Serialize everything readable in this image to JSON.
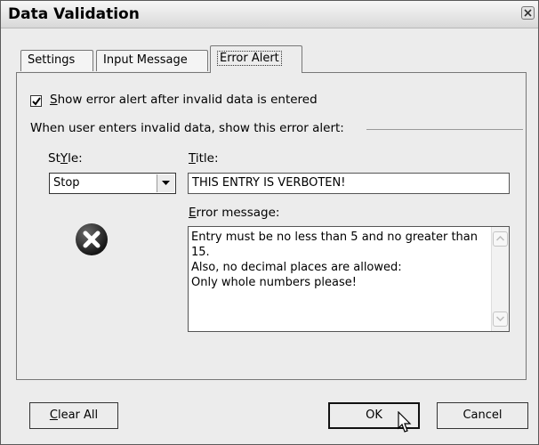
{
  "window": {
    "title": "Data Validation"
  },
  "tabs": [
    {
      "label": "Settings",
      "selected": false
    },
    {
      "label": "Input Message",
      "selected": false
    },
    {
      "label": "Error Alert",
      "selected": true
    }
  ],
  "show_error_checkbox": {
    "label_accel": "S",
    "label_rest": "how error alert after invalid data is entered",
    "checked": true
  },
  "group_label": "When user enters invalid data, show this error alert:",
  "style": {
    "label_accel": "Y",
    "label_before": "St",
    "label_after": "le:",
    "selected": "Stop",
    "icon": "stop-x-icon"
  },
  "title_field": {
    "label_accel": "T",
    "label_rest": "itle:",
    "value": "THIS ENTRY IS VERBOTEN!"
  },
  "error_message": {
    "label_accel": "E",
    "label_rest": "rror message:",
    "value": "Entry must be no less than 5 and no greater than 15.\nAlso, no decimal places are allowed:\nOnly whole numbers please!"
  },
  "buttons": {
    "clear_all_accel": "C",
    "clear_all_rest": "lear All",
    "ok": "OK",
    "cancel": "Cancel"
  },
  "colors": {
    "dialog_bg": "#ececec",
    "field_bg": "#ffffff"
  }
}
